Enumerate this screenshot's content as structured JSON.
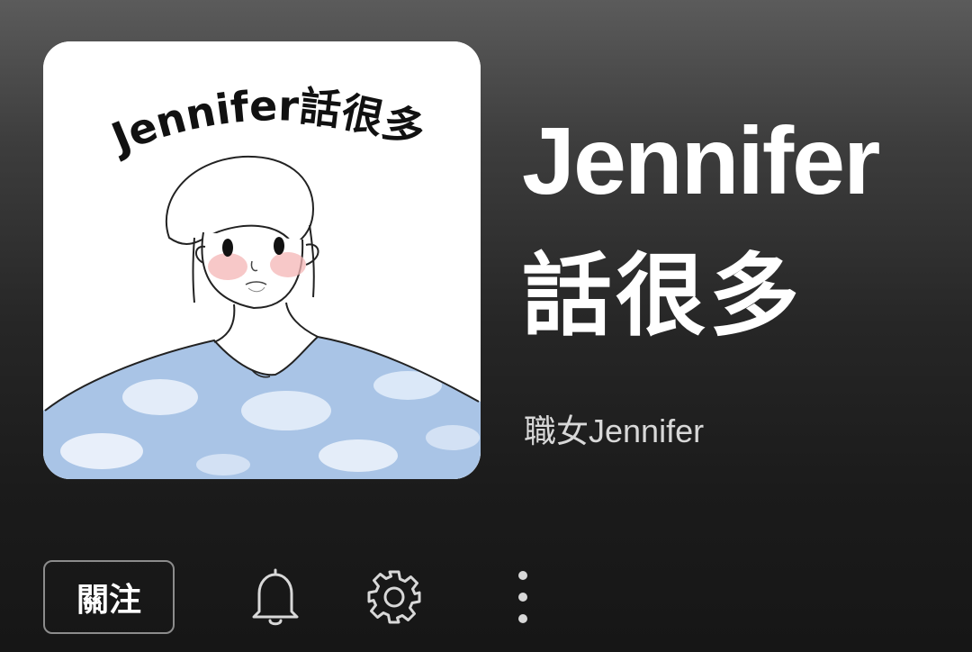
{
  "podcast": {
    "cover_title": "Jennifer話很多",
    "title_line1": "Jennifer",
    "title_line2": "話很多",
    "author": "職女Jennifer"
  },
  "actions": {
    "follow_label": "關注",
    "notification_icon": "bell-icon",
    "settings_icon": "gear-icon",
    "more_icon": "more-vertical-icon"
  },
  "colors": {
    "background_top": "#5b5b5b",
    "background_bottom": "#161616",
    "text_primary": "#ffffff",
    "text_secondary": "#d8d8d8",
    "button_border": "#8c8c8c",
    "sweater_blue": "#a9c4e6"
  }
}
